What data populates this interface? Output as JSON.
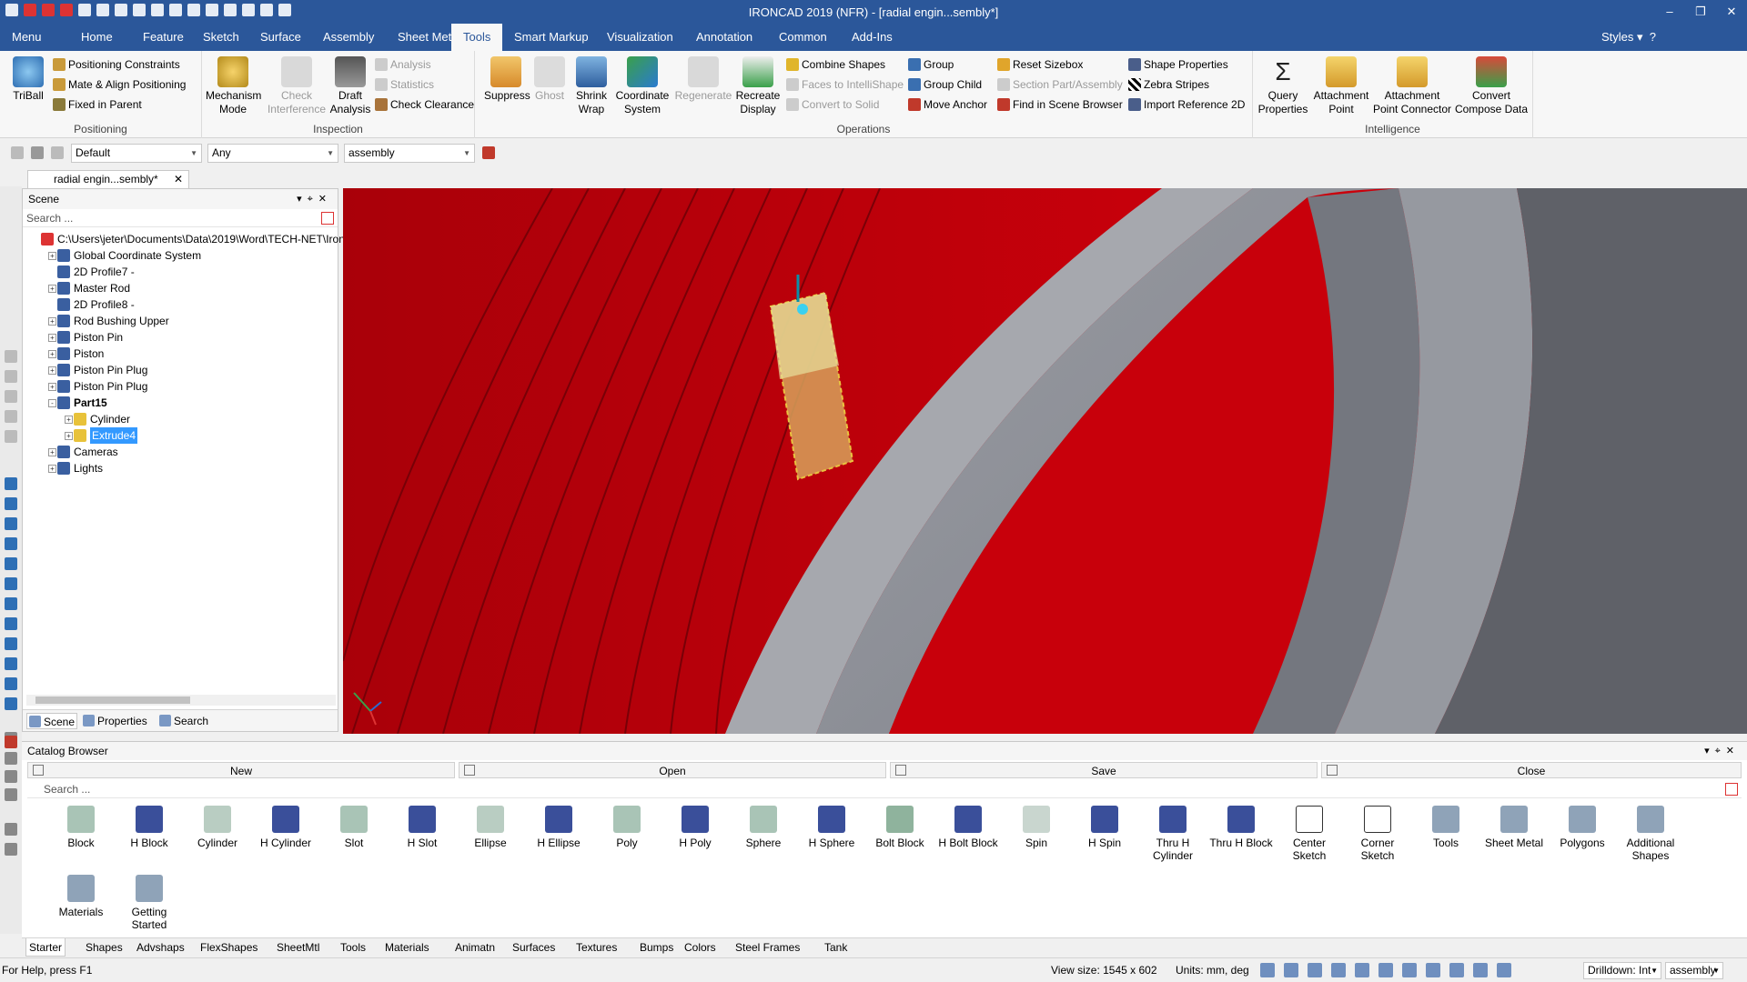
{
  "window": {
    "title": "IRONCAD 2019 (NFR) - [radial engin...sembly*]"
  },
  "menu_tabs": [
    "Menu",
    "Home",
    "Feature",
    "Sketch",
    "Surface",
    "Assembly",
    "Sheet Metal",
    "Tools",
    "Smart Markup",
    "Visualization",
    "Annotation",
    "Common",
    "Add-Ins"
  ],
  "active_tab": "Tools",
  "styles_label": "Styles",
  "ribbon": {
    "positioning": {
      "label": "Positioning",
      "triball": "TriBall",
      "items": [
        "Positioning Constraints",
        "Mate & Align Positioning",
        "Fixed in Parent"
      ]
    },
    "inspection": {
      "label": "Inspection",
      "mechanism_mode": [
        "Mechanism",
        "Mode"
      ],
      "check_interference": [
        "Check",
        "Interference"
      ],
      "draft_analysis": [
        "Draft",
        "Analysis"
      ],
      "items": [
        "Analysis",
        "Statistics",
        "Check Clearance"
      ]
    },
    "operations": {
      "label": "Operations",
      "suppress": "Suppress",
      "ghost": "Ghost",
      "shrink_wrap": [
        "Shrink",
        "Wrap"
      ],
      "coordinate_system": [
        "Coordinate",
        "System"
      ],
      "regenerate": "Regenerate",
      "recreate_display": [
        "Recreate",
        "Display"
      ],
      "col1": [
        "Combine Shapes",
        "Faces to IntelliShape",
        "Convert to Solid"
      ],
      "col2": [
        "Group",
        "Group Child",
        "Move Anchor"
      ],
      "col3": [
        "Reset Sizebox",
        "Section Part/Assembly",
        "Find in Scene Browser"
      ],
      "col4": [
        "Shape Properties",
        "Zebra Stripes",
        "Import Reference 2D"
      ]
    },
    "intelligence": {
      "label": "Intelligence",
      "query_properties": [
        "Query",
        "Properties"
      ],
      "attachment_point": [
        "Attachment",
        "Point"
      ],
      "attachment_point_connector": [
        "Attachment",
        "Point Connector"
      ],
      "convert_compose_data": [
        "Convert",
        "Compose Data"
      ]
    }
  },
  "toolbar2": {
    "style_combo": "Default",
    "filter_combo": "Any",
    "level_combo": "assembly"
  },
  "doc_tab": "radial engin...sembly*",
  "scene": {
    "header": "Scene",
    "search_placeholder": "Search ...",
    "tree": [
      {
        "label": "C:\\Users\\jeter\\Documents\\Data\\2019\\Word\\TECH-NET\\Iron",
        "level": 0,
        "expander": ""
      },
      {
        "label": "Global Coordinate System",
        "level": 1,
        "expander": "+"
      },
      {
        "label": "2D Profile7 -",
        "level": 1,
        "expander": ""
      },
      {
        "label": "Master Rod",
        "level": 1,
        "expander": "+"
      },
      {
        "label": "2D Profile8 -",
        "level": 1,
        "expander": ""
      },
      {
        "label": "Rod Bushing Upper",
        "level": 1,
        "expander": "+"
      },
      {
        "label": "Piston Pin",
        "level": 1,
        "expander": "+"
      },
      {
        "label": "Piston",
        "level": 1,
        "expander": "+"
      },
      {
        "label": "Piston Pin Plug",
        "level": 1,
        "expander": "+"
      },
      {
        "label": "Piston Pin Plug",
        "level": 1,
        "expander": "+"
      },
      {
        "label": "Part15",
        "level": 1,
        "expander": "-",
        "bold": true
      },
      {
        "label": "Cylinder",
        "level": 2,
        "expander": "+"
      },
      {
        "label": "Extrude4",
        "level": 2,
        "expander": "+",
        "selected": true
      },
      {
        "label": "Cameras",
        "level": 1,
        "expander": "+"
      },
      {
        "label": "Lights",
        "level": 1,
        "expander": "+"
      }
    ],
    "panel_tabs": [
      "Scene",
      "Properties",
      "Search"
    ]
  },
  "catalog": {
    "header": "Catalog Browser",
    "buttons": [
      "New",
      "Open",
      "Save",
      "Close"
    ],
    "search_placeholder": "Search ...",
    "items": [
      {
        "label": "Block",
        "color": "#a9c4b6"
      },
      {
        "label": "H Block",
        "color": "#3a4f9a"
      },
      {
        "label": "Cylinder",
        "color": "#b9cdc2"
      },
      {
        "label": "H Cylinder",
        "color": "#3a4f9a"
      },
      {
        "label": "Slot",
        "color": "#a9c4b6"
      },
      {
        "label": "H Slot",
        "color": "#3a4f9a"
      },
      {
        "label": "Ellipse",
        "color": "#b9cdc2"
      },
      {
        "label": "H Ellipse",
        "color": "#3a4f9a"
      },
      {
        "label": "Poly",
        "color": "#a9c4b6"
      },
      {
        "label": "H Poly",
        "color": "#3a4f9a"
      },
      {
        "label": "Sphere",
        "color": "#a9c4b6"
      },
      {
        "label": "H Sphere",
        "color": "#3a4f9a"
      },
      {
        "label": "Bolt Block",
        "color": "#8fb39d"
      },
      {
        "label": "H Bolt Block",
        "color": "#3a4f9a"
      },
      {
        "label": "Spin",
        "color": "#c9d6cf"
      },
      {
        "label": "H Spin",
        "color": "#3a4f9a"
      },
      {
        "label": "Thru H Cylinder",
        "color": "#3a4f9a"
      },
      {
        "label": "Thru H Block",
        "color": "#3a4f9a"
      },
      {
        "label": "Center Sketch",
        "color": "#ffffff"
      },
      {
        "label": "Corner Sketch",
        "color": "#ffffff"
      },
      {
        "label": "Tools",
        "color": "#8fa3b8"
      },
      {
        "label": "Sheet Metal",
        "color": "#8fa3b8"
      },
      {
        "label": "Polygons",
        "color": "#8fa3b8"
      },
      {
        "label": "Additional Shapes",
        "color": "#8fa3b8"
      },
      {
        "label": "Materials",
        "color": "#8fa3b8"
      },
      {
        "label": "Getting Started",
        "color": "#8fa3b8"
      }
    ],
    "bottom_tabs": [
      "Starter",
      "Shapes",
      "Advshaps",
      "FlexShapes",
      "SheetMtl",
      "Tools",
      "Materials",
      "Animatn",
      "Surfaces",
      "Textures",
      "Bumps",
      "Colors",
      "Steel Frames",
      "Tank"
    ]
  },
  "status": {
    "help": "For Help, press F1",
    "view_size": "View size: 1545 x  602",
    "units": "Units: mm, deg",
    "drilldown": "Drilldown: Int",
    "level": "assembly"
  },
  "colors": {
    "accent": "#2b579a",
    "part_red": "#c8000b",
    "ring_gray": "#8e9097"
  }
}
